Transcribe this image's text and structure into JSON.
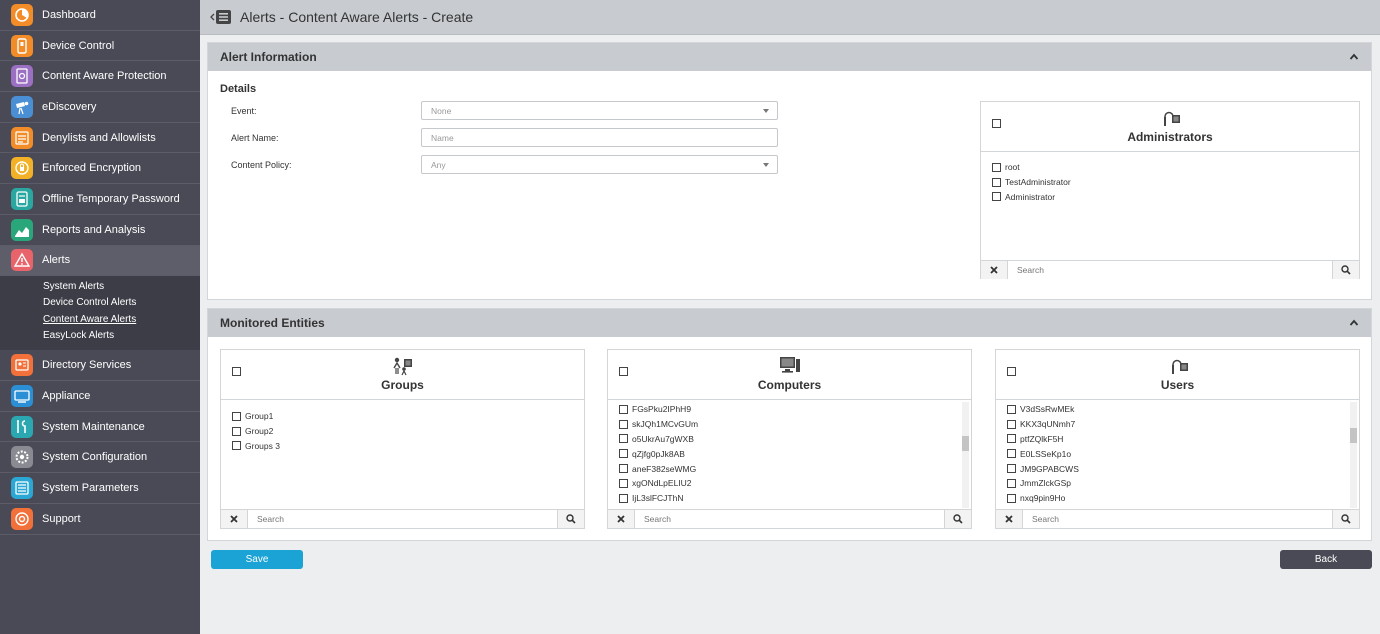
{
  "nav": {
    "items": [
      {
        "key": "dashboard",
        "label": "Dashboard",
        "color": "#f28c28"
      },
      {
        "key": "device-control",
        "label": "Device Control",
        "color": "#f28c28"
      },
      {
        "key": "content-aware-protection",
        "label": "Content Aware Protection",
        "color": "#9b6fc2"
      },
      {
        "key": "ediscovery",
        "label": "eDiscovery",
        "color": "#4a8fd4"
      },
      {
        "key": "denylists",
        "label": "Denylists and Allowlists",
        "color": "#f28c28"
      },
      {
        "key": "enforced-encryption",
        "label": "Enforced Encryption",
        "color": "#f2b126"
      },
      {
        "key": "offline-password",
        "label": "Offline Temporary Password",
        "color": "#2aa7a0"
      },
      {
        "key": "reports",
        "label": "Reports and Analysis",
        "color": "#2aa77a"
      },
      {
        "key": "alerts",
        "label": "Alerts",
        "color": "#e8646a"
      }
    ],
    "alerts_sub": [
      {
        "label": "System Alerts"
      },
      {
        "label": "Device Control Alerts"
      },
      {
        "label": "Content Aware Alerts"
      },
      {
        "label": "EasyLock Alerts"
      }
    ],
    "items_after": [
      {
        "key": "directory-services",
        "label": "Directory Services",
        "color": "#f2703a"
      },
      {
        "key": "appliance",
        "label": "Appliance",
        "color": "#2a8fd4"
      },
      {
        "key": "system-maintenance",
        "label": "System Maintenance",
        "color": "#2aa7b0"
      },
      {
        "key": "system-configuration",
        "label": "System Configuration",
        "color": "#8a8a92"
      },
      {
        "key": "system-parameters",
        "label": "System Parameters",
        "color": "#2aa7d4"
      },
      {
        "key": "support",
        "label": "Support",
        "color": "#f2703a"
      }
    ]
  },
  "header": {
    "title": "Alerts - Content Aware Alerts - Create"
  },
  "alert_info": {
    "title": "Alert Information",
    "details_label": "Details",
    "fields": {
      "event_label": "Event:",
      "event_value": "None",
      "name_label": "Alert Name:",
      "name_placeholder": "Name",
      "policy_label": "Content Policy:",
      "policy_value": "Any"
    },
    "administrators": {
      "title": "Administrators",
      "items": [
        "root",
        "TestAdministrator",
        "Administrator"
      ],
      "search_placeholder": "Search"
    }
  },
  "monitored": {
    "title": "Monitored Entities",
    "groups": {
      "title": "Groups",
      "items": [
        "Group1",
        "Group2",
        "Groups 3"
      ],
      "search_placeholder": "Search"
    },
    "computers": {
      "title": "Computers",
      "items": [
        "FGsPku2IPhH9",
        "skJQh1MCvGUm",
        "o5UkrAu7gWXB",
        "qZjfg0pJk8AB",
        "aneF382seWMG",
        "xgONdLpELIU2",
        "IjL3slFCJThN"
      ],
      "search_placeholder": "Search"
    },
    "users": {
      "title": "Users",
      "items": [
        "V3dSsRwMEk",
        "KKX3qUNmh7",
        "ptfZQlkF5H",
        "E0LSSeKp1o",
        "JM9GPABCWS",
        "JmmZlckGSp",
        "nxq9pin9Ho"
      ],
      "search_placeholder": "Search"
    }
  },
  "actions": {
    "save_label": "Save",
    "back_label": "Back"
  }
}
